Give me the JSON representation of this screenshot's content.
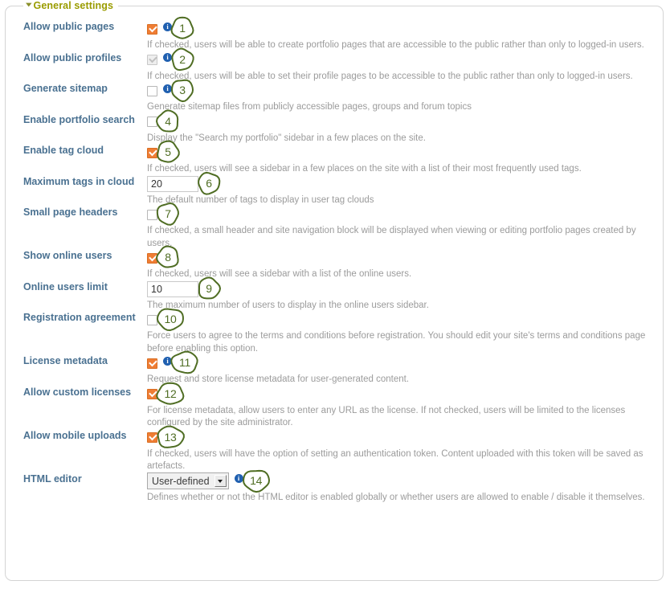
{
  "panel": {
    "legend": "General settings",
    "chevron_icon": "chevron-down-icon",
    "legend_color": "#9a9c00",
    "label_color": "#4a7191",
    "desc_color": "#9b9b9b",
    "checkbox_checked_color": "#ef7d34",
    "info_icon_color": "#2060b0",
    "callout_color": "#4f6d23"
  },
  "rows": [
    {
      "label": "Allow public pages",
      "control": "checkbox",
      "checked": true,
      "disabled": false,
      "info": true,
      "callout": "1",
      "description": "If checked, users will be able to create portfolio pages that are accessible to the public rather than only to logged-in users."
    },
    {
      "label": "Allow public profiles",
      "control": "checkbox",
      "checked": true,
      "disabled": true,
      "info": true,
      "callout": "2",
      "description": "If checked, users will be able to set their profile pages to be accessible to the public rather than only to logged-in users."
    },
    {
      "label": "Generate sitemap",
      "control": "checkbox",
      "checked": false,
      "disabled": false,
      "info": true,
      "callout": "3",
      "description": "Generate sitemap files from publicly accessible pages, groups and forum topics"
    },
    {
      "label": "Enable portfolio search",
      "control": "checkbox",
      "checked": false,
      "disabled": false,
      "info": false,
      "callout": "4",
      "description": "Display the \"Search my portfolio\" sidebar in a few places on the site."
    },
    {
      "label": "Enable tag cloud",
      "control": "checkbox",
      "checked": true,
      "disabled": false,
      "info": false,
      "callout": "5",
      "description": "If checked, users will see a sidebar in a few places on the site with a list of their most frequently used tags."
    },
    {
      "label": "Maximum tags in cloud",
      "control": "text",
      "value": "20",
      "info": false,
      "callout": "6",
      "description": "The default number of tags to display in user tag clouds"
    },
    {
      "label": "Small page headers",
      "control": "checkbox",
      "checked": false,
      "disabled": false,
      "info": false,
      "callout": "7",
      "description": "If checked, a small header and site navigation block will be displayed when viewing or editing portfolio pages created by users."
    },
    {
      "label": "Show online users",
      "control": "checkbox",
      "checked": true,
      "disabled": false,
      "info": false,
      "callout": "8",
      "description": "If checked, users will see a sidebar with a list of the online users."
    },
    {
      "label": "Online users limit",
      "control": "text",
      "value": "10",
      "info": false,
      "callout": "9",
      "description": "The maximum number of users to display in the online users sidebar."
    },
    {
      "label": "Registration agreement",
      "control": "checkbox",
      "checked": false,
      "disabled": false,
      "info": false,
      "callout": "10",
      "description": "Force users to agree to the terms and conditions before registration. You should edit your site's terms and conditions page before enabling this option."
    },
    {
      "label": "License metadata",
      "control": "checkbox",
      "checked": true,
      "disabled": false,
      "info": true,
      "callout": "11",
      "description": "Request and store license metadata for user-generated content."
    },
    {
      "label": "Allow custom licenses",
      "control": "checkbox",
      "checked": true,
      "disabled": false,
      "info": false,
      "callout": "12",
      "description": "For license metadata, allow users to enter any URL as the license. If not checked, users will be limited to the licenses configured by the site administrator."
    },
    {
      "label": "Allow mobile uploads",
      "control": "checkbox",
      "checked": true,
      "disabled": false,
      "info": false,
      "callout": "13",
      "description": "If checked, users will have the option of setting an authentication token. Content uploaded with this token will be saved as artefacts."
    },
    {
      "label": "HTML editor",
      "control": "select",
      "value": "User-defined",
      "info": true,
      "callout": "14",
      "description": "Defines whether or not the HTML editor is enabled globally or whether users are allowed to enable / disable it themselves."
    }
  ]
}
